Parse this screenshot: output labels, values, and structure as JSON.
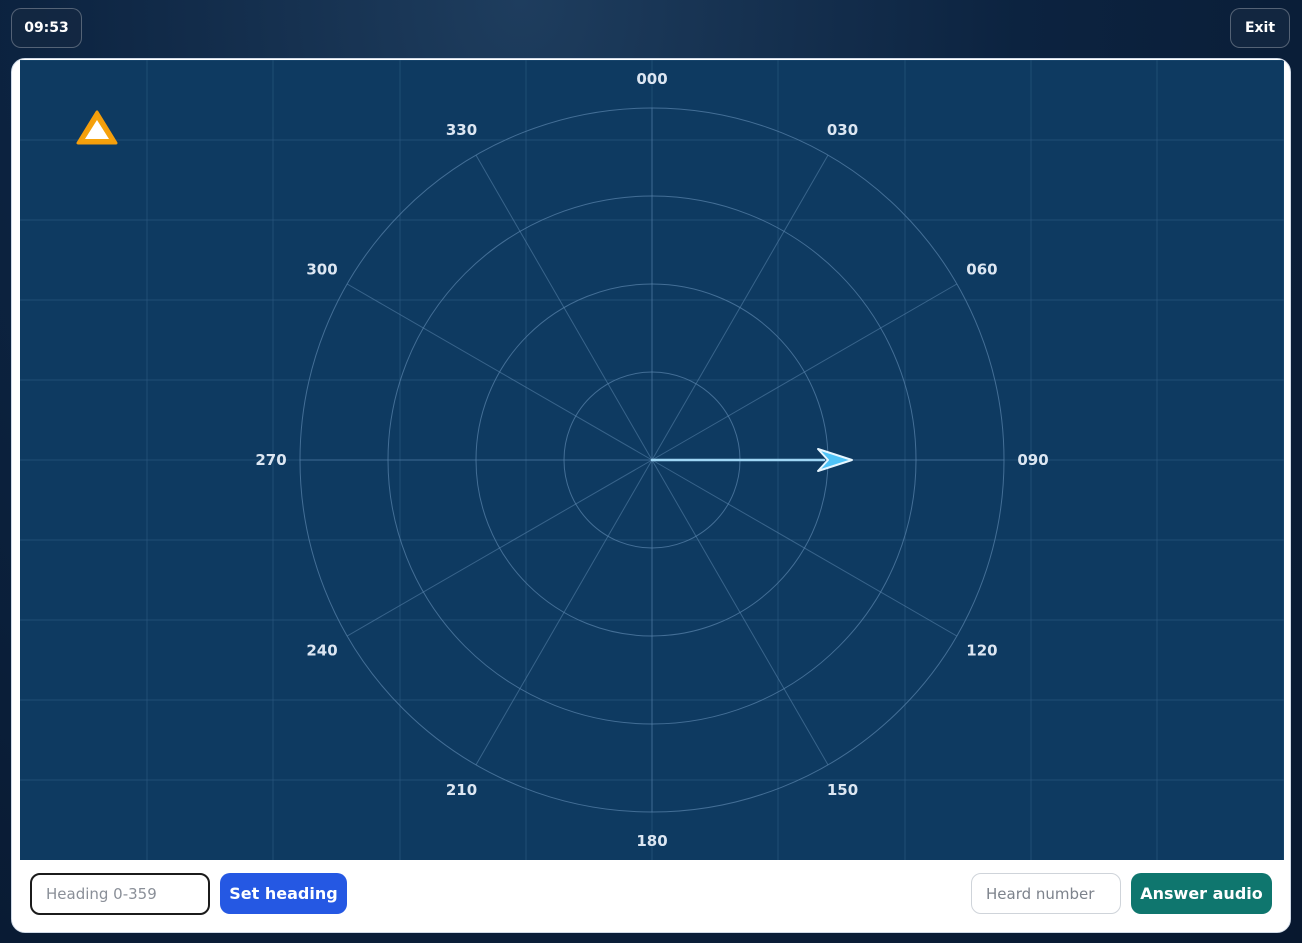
{
  "header": {
    "timer": "09:53",
    "exit_label": "Exit"
  },
  "radar": {
    "compass_labels": [
      "000",
      "030",
      "060",
      "090",
      "120",
      "150",
      "180",
      "210",
      "240",
      "270",
      "300",
      "330"
    ],
    "aircraft_heading_deg": 90,
    "warning_icon": "warning-triangle-icon",
    "colors": {
      "board": "#0e3a61",
      "aircraft": "#4fc3f7",
      "warning": "#f59e0b"
    }
  },
  "controls": {
    "heading_placeholder": "Heading 0-359",
    "set_heading_label": "Set heading",
    "heard_placeholder": "Heard number",
    "answer_label": "Answer audio"
  }
}
